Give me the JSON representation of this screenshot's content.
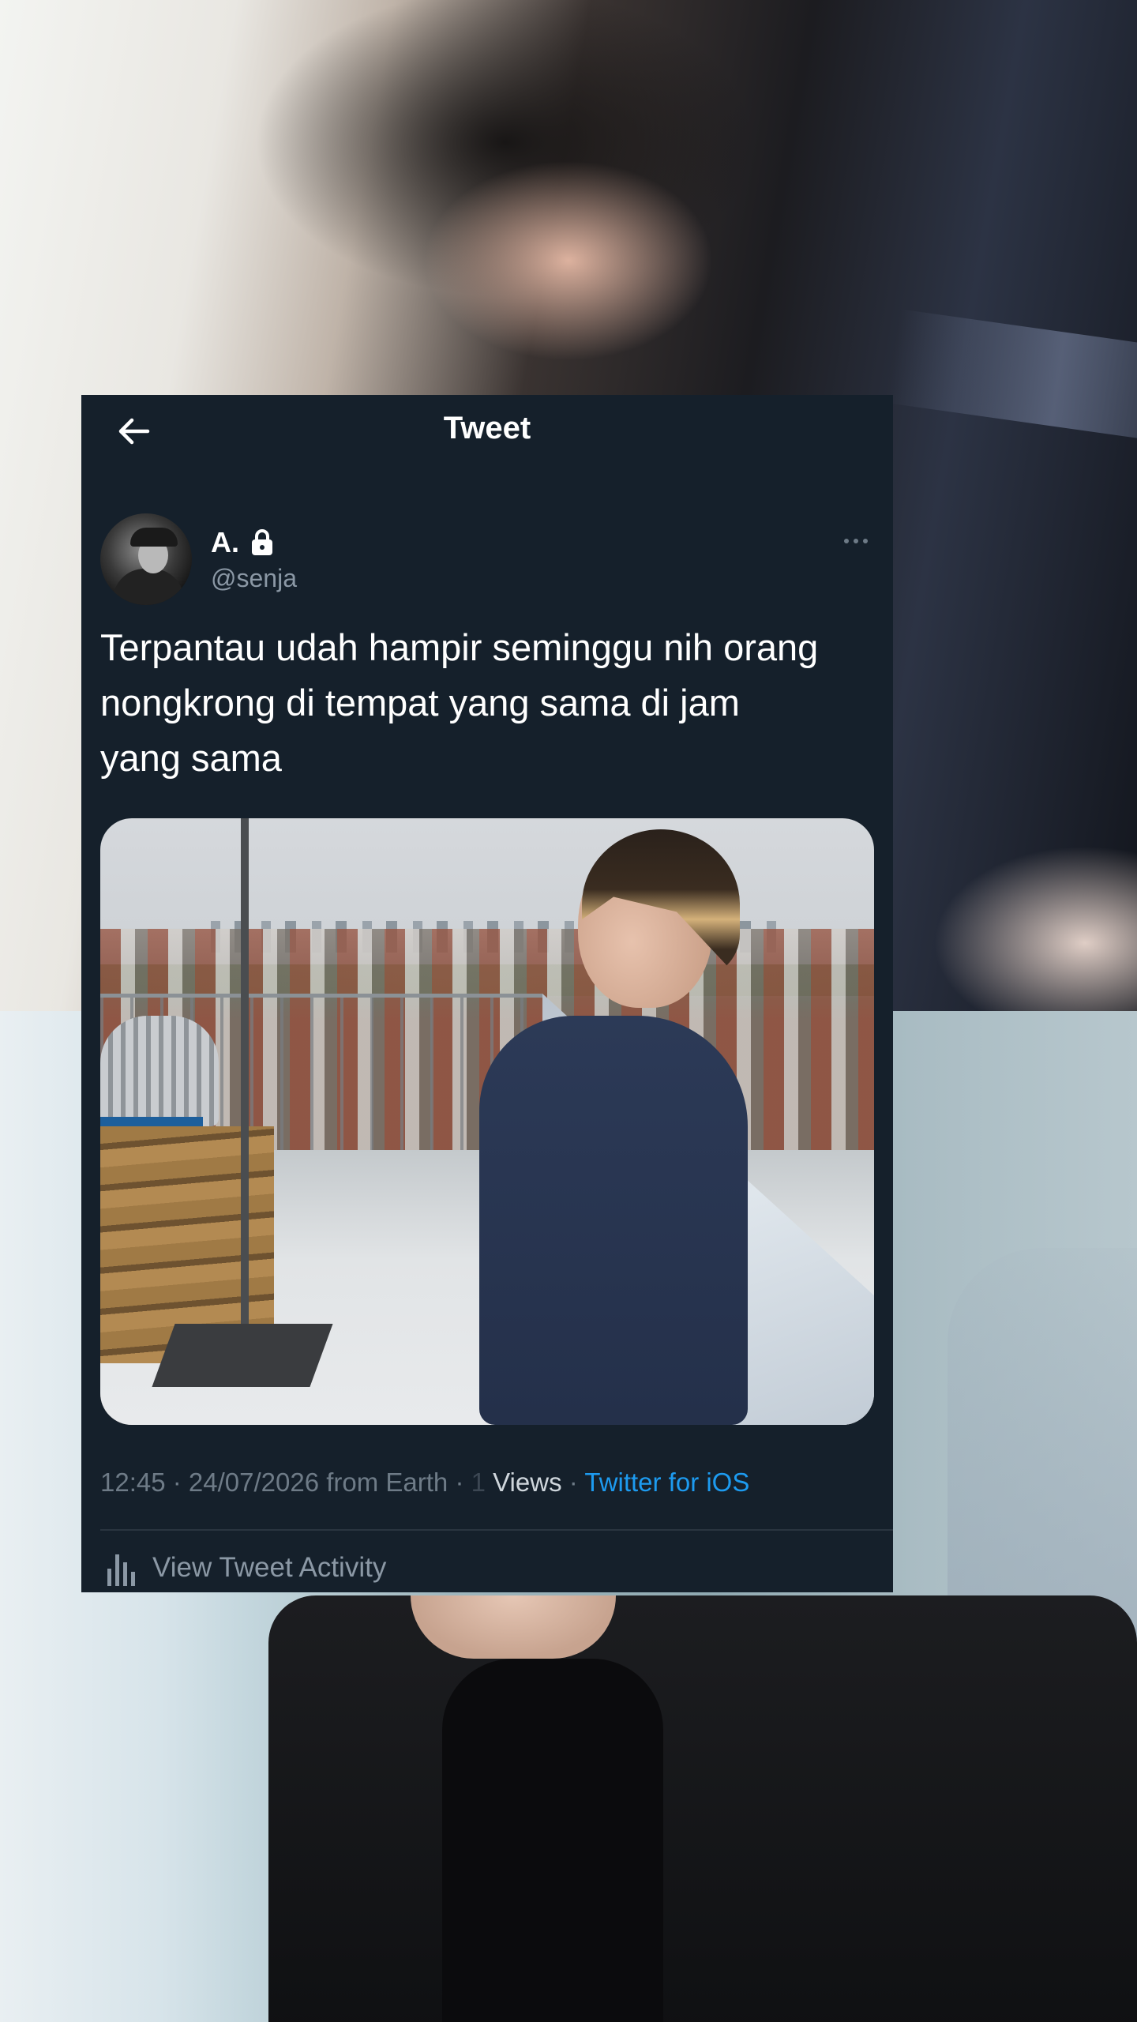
{
  "header": {
    "title": "Tweet"
  },
  "author": {
    "display_name": "A.",
    "handle": "@senja"
  },
  "tweet": {
    "text_lines": [
      "Terpantau udah hampir seminggu nih orang",
      "nongkrong di tempat yang sama di jam",
      "yang sama"
    ]
  },
  "meta": {
    "timestamp": "12:45 · 24/07/2026 from Earth ·",
    "views_count": "1",
    "views_label": "Views",
    "separator": "·",
    "client": "Twitter for iOS"
  },
  "activity": {
    "label": "View Tweet Activity"
  },
  "colors": {
    "card_background": "#15202b",
    "link": "#1d9bf0",
    "secondary_text": "#8b98a5"
  },
  "icons": {
    "back": "arrow-left-icon",
    "lock": "lock-icon",
    "more": "more-horizontal-icon",
    "activity": "bar-chart-icon"
  }
}
